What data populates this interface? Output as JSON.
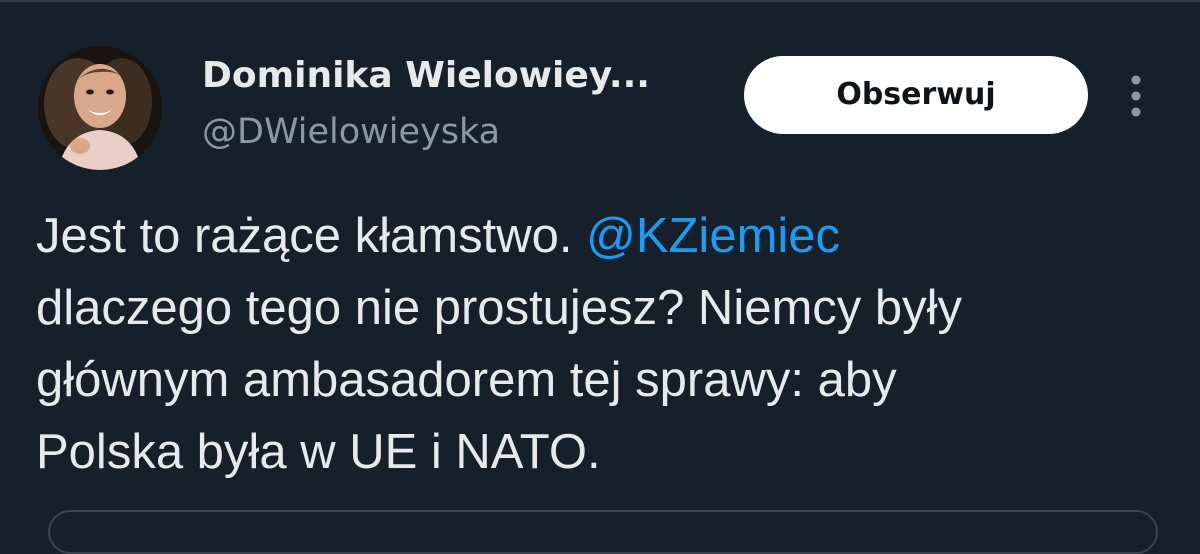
{
  "tweet": {
    "author": {
      "display_name": "Dominika Wielowiey...",
      "handle": "@DWielowieyska"
    },
    "follow_label": "Obserwuj",
    "text": {
      "line1_before": "Jest to rażące kłamstwo. ",
      "mention": "@KZiemiec",
      "line2": "dlaczego tego nie prostujesz? Niemcy były",
      "line3": "głównym ambasadorem tej sprawy: aby",
      "line4": "Polska była w UE i NATO."
    }
  },
  "colors": {
    "background": "#15202b",
    "text": "#e7e9ea",
    "secondary_text": "#8b98a5",
    "mention": "#1d9bf0",
    "button_bg": "#ffffff",
    "button_text": "#0f1419"
  },
  "icons": {
    "more": "more-vertical-icon"
  }
}
